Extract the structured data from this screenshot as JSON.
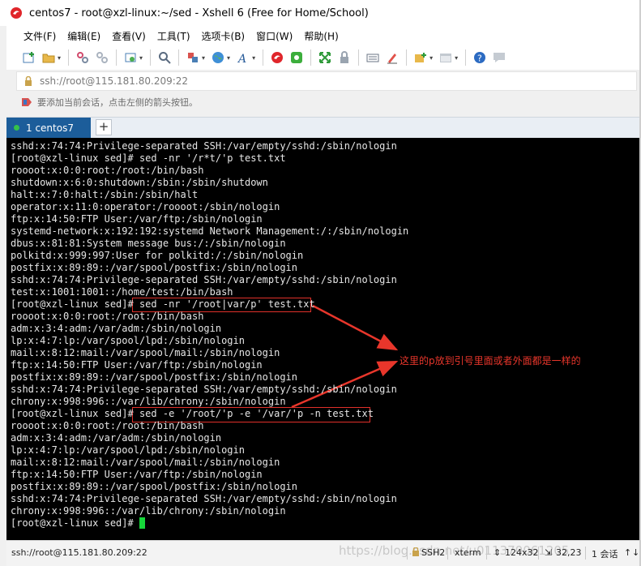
{
  "window": {
    "title": "centos7 - root@xzl-linux:~/sed - Xshell 6 (Free for Home/School)"
  },
  "menu": [
    "文件(F)",
    "编辑(E)",
    "查看(V)",
    "工具(T)",
    "选项卡(B)",
    "窗口(W)",
    "帮助(H)"
  ],
  "toolbar_icons": [
    "new-session-icon",
    "open-folder-icon",
    "connect-icon",
    "disconnect-icon",
    "properties-icon",
    "find-icon",
    "transfer-icon",
    "globe-icon",
    "font-icon",
    "xshell-icon",
    "xftp-icon",
    "fullscreen-icon",
    "lock-icon",
    "keyboard-icon",
    "highlight-icon",
    "new-tab-icon",
    "layout-icon",
    "help-icon",
    "chat-icon"
  ],
  "address": {
    "value": "ssh://root@115.181.80.209:22"
  },
  "hint": {
    "text": "要添加当前会话，点击左侧的箭头按钮。"
  },
  "tabs": [
    {
      "label": "1 centos7",
      "status_color": "#35c24a"
    }
  ],
  "new_tab_label": "+",
  "terminal": {
    "lines": [
      "sshd:x:74:74:Privilege-separated SSH:/var/empty/sshd:/sbin/nologin",
      "[root@xzl-linux sed]# sed -nr '/r*t/'p test.txt",
      "roooot:x:0:0:root:/root:/bin/bash",
      "shutdown:x:6:0:shutdown:/sbin:/sbin/shutdown",
      "halt:x:7:0:halt:/sbin:/sbin/halt",
      "operator:x:11:0:operator:/roooot:/sbin/nologin",
      "ftp:x:14:50:FTP User:/var/ftp:/sbin/nologin",
      "systemd-network:x:192:192:systemd Network Management:/:/sbin/nologin",
      "dbus:x:81:81:System message bus:/:/sbin/nologin",
      "polkitd:x:999:997:User for polkitd:/:/sbin/nologin",
      "postfix:x:89:89::/var/spool/postfix:/sbin/nologin",
      "sshd:x:74:74:Privilege-separated SSH:/var/empty/sshd:/sbin/nologin",
      "test:x:1001:1001::/home/test:/bin/bash",
      "[root@xzl-linux sed]# sed -nr '/root|var/p' test.txt",
      "roooot:x:0:0:root:/root:/bin/bash",
      "adm:x:3:4:adm:/var/adm:/sbin/nologin",
      "lp:x:4:7:lp:/var/spool/lpd:/sbin/nologin",
      "mail:x:8:12:mail:/var/spool/mail:/sbin/nologin",
      "ftp:x:14:50:FTP User:/var/ftp:/sbin/nologin",
      "postfix:x:89:89::/var/spool/postfix:/sbin/nologin",
      "sshd:x:74:74:Privilege-separated SSH:/var/empty/sshd:/sbin/nologin",
      "chrony:x:998:996::/var/lib/chrony:/sbin/nologin",
      "[root@xzl-linux sed]# sed -e '/root/'p -e '/var/'p -n test.txt",
      "roooot:x:0:0:root:/root:/bin/bash",
      "adm:x:3:4:adm:/var/adm:/sbin/nologin",
      "lp:x:4:7:lp:/var/spool/lpd:/sbin/nologin",
      "mail:x:8:12:mail:/var/spool/mail:/sbin/nologin",
      "ftp:x:14:50:FTP User:/var/ftp:/sbin/nologin",
      "postfix:x:89:89::/var/spool/postfix:/sbin/nologin",
      "sshd:x:74:74:Privilege-separated SSH:/var/empty/sshd:/sbin/nologin",
      "chrony:x:998:996::/var/lib/chrony:/sbin/nologin",
      "[root@xzl-linux sed]# "
    ],
    "annotation": "这里的p放到引号里面或者外面都是一样的",
    "cursor_color": "#16d73a",
    "highlight_color": "#e0302a"
  },
  "status": {
    "address": "ssh://root@115.181.80.209:22",
    "protocol": "SSH2",
    "term": "xterm",
    "size": "124x32",
    "position": "32,23",
    "sessions": "1 会话"
  },
  "watermark": "https://blog.csdn.net/u011370061205"
}
